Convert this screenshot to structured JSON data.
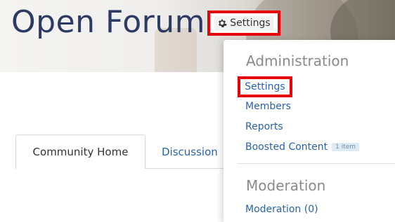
{
  "header": {
    "title": "Open Forum",
    "settings_button_label": "Settings"
  },
  "tabs": [
    {
      "label": "Community Home",
      "active": true
    },
    {
      "label": "Discussion",
      "active": false
    }
  ],
  "dropdown": {
    "administration": {
      "heading": "Administration",
      "items": [
        {
          "label": "Settings",
          "highlighted": true
        },
        {
          "label": "Members"
        },
        {
          "label": "Reports"
        },
        {
          "label": "Boosted Content",
          "badge": "1 item"
        }
      ]
    },
    "moderation": {
      "heading": "Moderation",
      "items": [
        {
          "label": "Moderation (0)"
        }
      ]
    }
  },
  "colors": {
    "title": "#2c3a64",
    "link": "#2b63a6",
    "highlight_border": "#e8000b",
    "heading": "#8a8a8a"
  },
  "icons": {
    "settings_button": "gear-icon"
  }
}
